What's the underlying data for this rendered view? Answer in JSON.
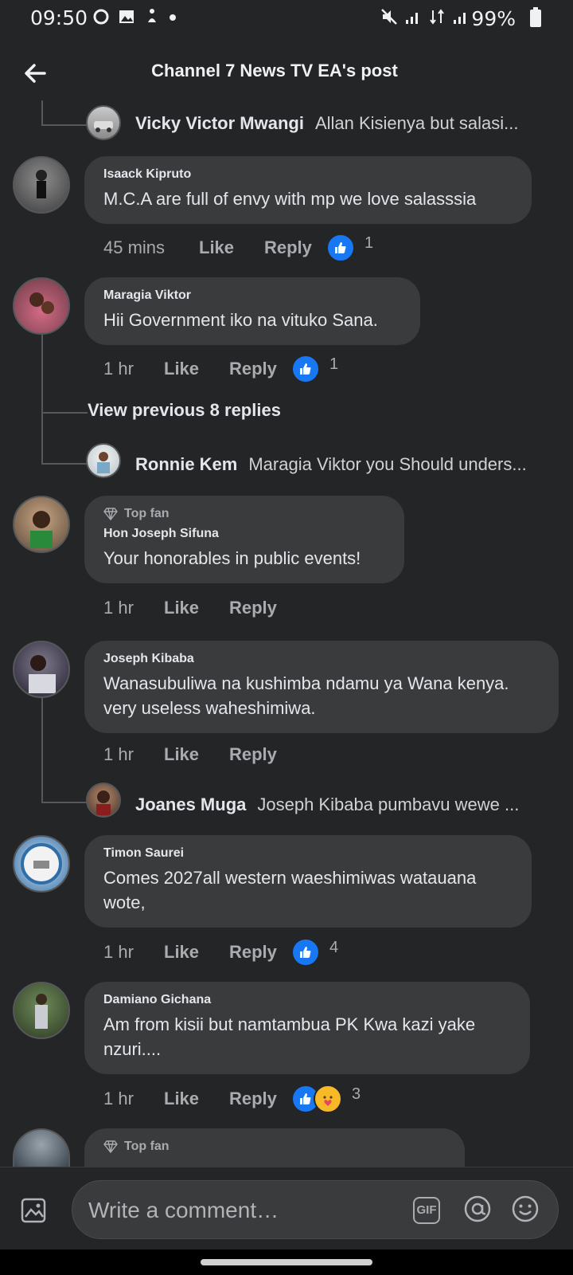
{
  "status_bar": {
    "time": "09:50",
    "battery": "99%"
  },
  "header": {
    "title": "Channel 7 News TV EA's post"
  },
  "comments": [
    {
      "name": "Isaack Kipruto",
      "text": "M.C.A are full of envy with mp we love salasssia",
      "time": "45 mins",
      "like": "Like",
      "reply": "Reply",
      "reaction_count": "1"
    },
    {
      "name": "Maragia Viktor",
      "text": "Hii Government iko na vituko Sana.",
      "time": "1 hr",
      "like": "Like",
      "reply": "Reply",
      "reaction_count": "1"
    },
    {
      "badge": "Top fan",
      "name": "Hon Joseph Sifuna",
      "text": "Your honorables in public events!",
      "time": "1 hr",
      "like": "Like",
      "reply": "Reply"
    },
    {
      "name": "Joseph Kibaba",
      "text": "Wanasubuliwa na kushimba ndamu ya Wana kenya. very useless waheshimiwa.",
      "time": "1 hr",
      "like": "Like",
      "reply": "Reply"
    },
    {
      "name": "Timon Saurei",
      "text": "Comes 2027all western waeshimiwas watauana wote,",
      "time": "1 hr",
      "like": "Like",
      "reply": "Reply",
      "reaction_count": "4"
    },
    {
      "name": "Damiano Gichana",
      "text": "Am from kisii but namtambua PK Kwa kazi yake nzuri....",
      "time": "1 hr",
      "like": "Like",
      "reply": "Reply",
      "reaction_count": "3"
    },
    {
      "badge": "Top fan"
    }
  ],
  "replies": [
    {
      "name": "Vicky Victor Mwangi",
      "text": "Allan Kisienya but salasi..."
    },
    {
      "name": "Ronnie Kem",
      "text": "Maragia Viktor you Should unders..."
    },
    {
      "name": "Joanes Muga",
      "text": "Joseph Kibaba pumbavu wewe ..."
    }
  ],
  "view_previous": "View previous 8 replies",
  "composer": {
    "placeholder": "Write a comment…",
    "gif": "GIF"
  },
  "colors": {
    "background": "#242527",
    "bubble": "#3a3b3d",
    "like_blue": "#1877f2",
    "care_yellow": "#f7b928"
  },
  "icons": [
    "back-arrow-icon",
    "like-reaction-icon",
    "care-reaction-icon",
    "diamond-icon",
    "photo-icon",
    "gif-icon",
    "at-icon",
    "emoji-icon"
  ]
}
